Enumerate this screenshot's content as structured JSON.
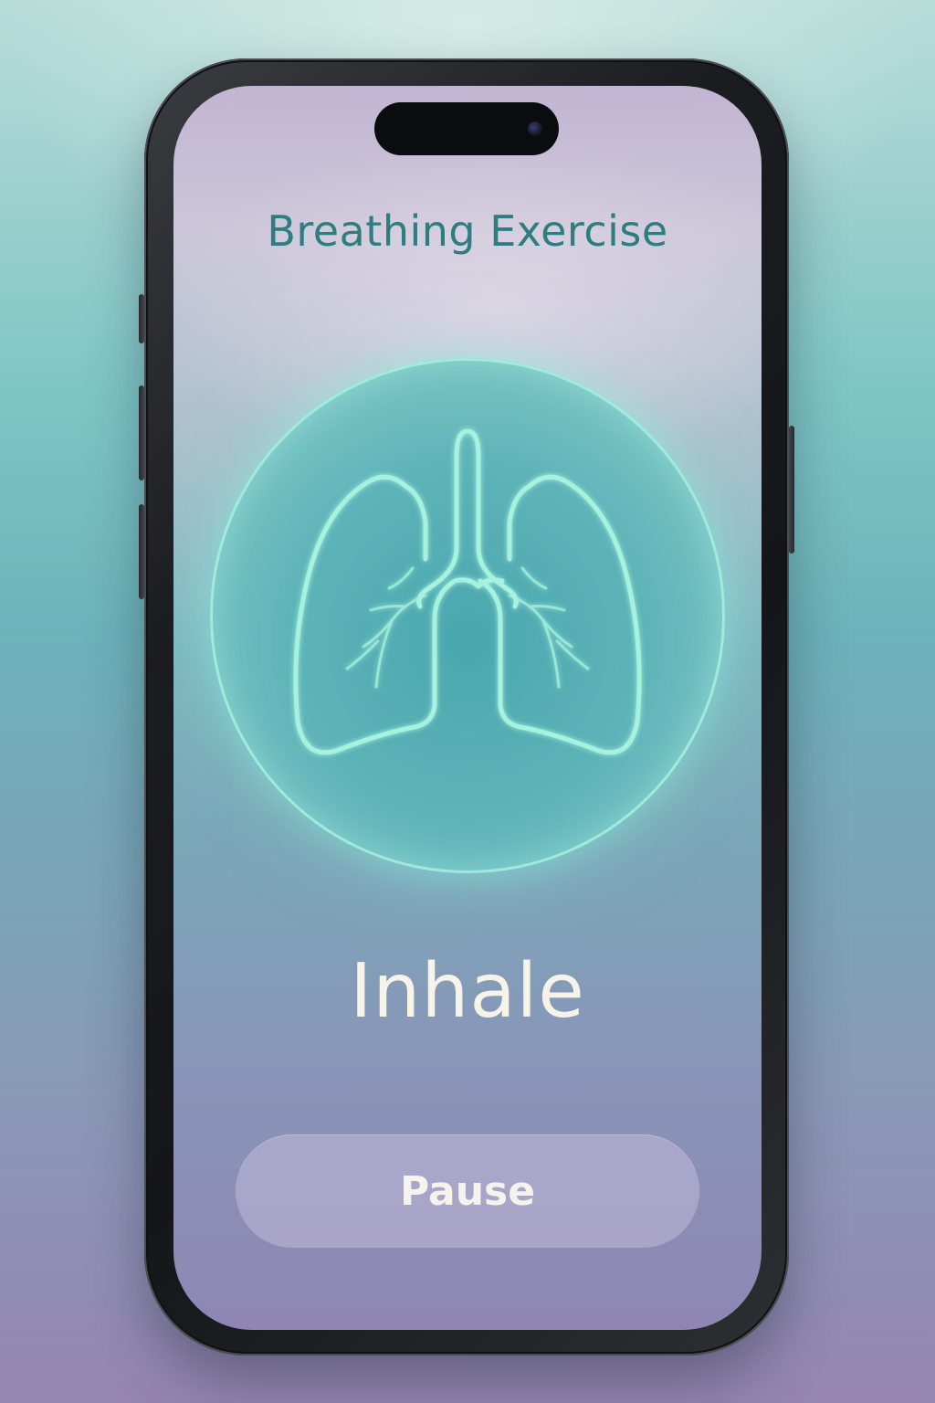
{
  "app": {
    "title": "Breathing Exercise"
  },
  "session": {
    "phase_label": "Inhale",
    "illustration_icon": "lungs-icon"
  },
  "controls": {
    "pause_label": "Pause"
  },
  "colors": {
    "title": "#2f7d80",
    "accent_glow": "#8cebdc",
    "phase_text": "#f7f3e8",
    "button_text": "#f6f2ee"
  }
}
